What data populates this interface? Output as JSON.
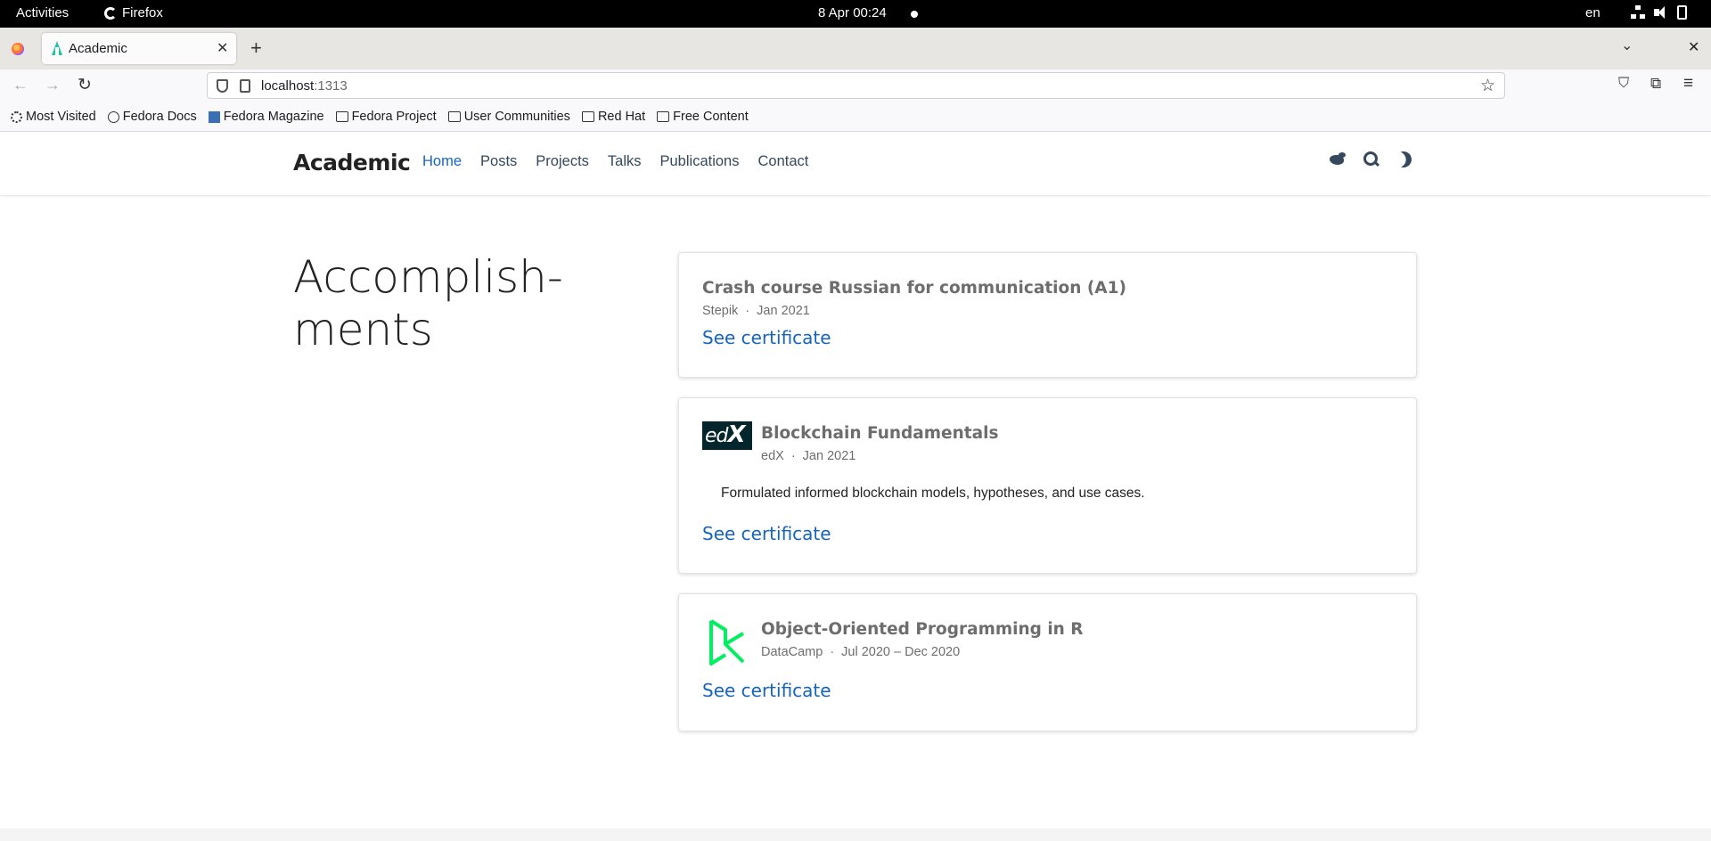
{
  "system": {
    "activities": "Activities",
    "app_name": "Firefox",
    "clock": "8 Apr  00:24",
    "lang": "en"
  },
  "browser": {
    "tab_title": "Academic",
    "url_host": "localhost",
    "url_port": ":1313",
    "bookmarks": [
      {
        "label": "Most Visited",
        "icon": "gear-icon"
      },
      {
        "label": "Fedora Docs",
        "icon": "globe-icon"
      },
      {
        "label": "Fedora Magazine",
        "icon": "fedora-magazine-icon"
      },
      {
        "label": "Fedora Project",
        "icon": "folder-icon"
      },
      {
        "label": "User Communities",
        "icon": "folder-icon"
      },
      {
        "label": "Red Hat",
        "icon": "folder-icon"
      },
      {
        "label": "Free Content",
        "icon": "folder-icon"
      }
    ]
  },
  "site": {
    "brand": "Academic",
    "nav": [
      {
        "label": "Home",
        "active": true
      },
      {
        "label": "Posts",
        "active": false
      },
      {
        "label": "Projects",
        "active": false
      },
      {
        "label": "Talks",
        "active": false
      },
      {
        "label": "Publications",
        "active": false
      },
      {
        "label": "Contact",
        "active": false
      }
    ],
    "accent_color": "#1565c0"
  },
  "main": {
    "section_title_line1": "Accomplish-",
    "section_title_line2": "ments",
    "cards": [
      {
        "title": "Crash course Russian for communication (A1)",
        "org": "Stepik",
        "date": "Jan 2021",
        "link": "See certificate"
      },
      {
        "title": "Blockchain Fundamentals",
        "org": "edX",
        "date": "Jan 2021",
        "description": "Formulated informed blockchain models, hypotheses, and use cases.",
        "link": "See certificate",
        "logo": "edX"
      },
      {
        "title": "Object-Oriented Programming in R",
        "org": "DataCamp",
        "date": "Jul 2020 – Dec 2020",
        "link": "See certificate",
        "logo": "datacamp-icon"
      }
    ]
  }
}
